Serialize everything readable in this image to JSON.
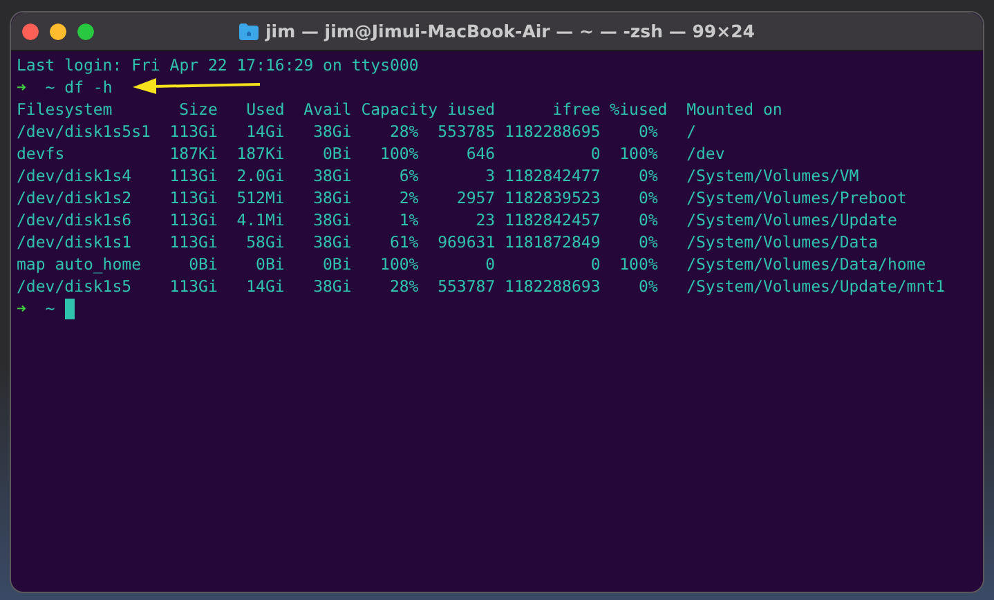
{
  "window": {
    "title": "jim — jim@Jimui-MacBook-Air — ~ — -zsh — 99×24"
  },
  "terminal": {
    "last_login": "Last login: Fri Apr 22 17:16:29 on ttys000",
    "command_prompt": {
      "arrow": "➜",
      "directory": "~",
      "command": "df -h"
    },
    "table": {
      "columns": [
        "Filesystem",
        "Size",
        "Used",
        "Avail",
        "Capacity",
        "iused",
        "ifree",
        "%iused",
        "Mounted on"
      ],
      "rows": [
        [
          "/dev/disk1s5s1",
          "113Gi",
          "14Gi",
          "38Gi",
          "28%",
          "553785",
          "1182288695",
          "0%",
          "/"
        ],
        [
          "devfs",
          "187Ki",
          "187Ki",
          "0Bi",
          "100%",
          "646",
          "0",
          "100%",
          "/dev"
        ],
        [
          "/dev/disk1s4",
          "113Gi",
          "2.0Gi",
          "38Gi",
          "6%",
          "3",
          "1182842477",
          "0%",
          "/System/Volumes/VM"
        ],
        [
          "/dev/disk1s2",
          "113Gi",
          "512Mi",
          "38Gi",
          "2%",
          "2957",
          "1182839523",
          "0%",
          "/System/Volumes/Preboot"
        ],
        [
          "/dev/disk1s6",
          "113Gi",
          "4.1Mi",
          "38Gi",
          "1%",
          "23",
          "1182842457",
          "0%",
          "/System/Volumes/Update"
        ],
        [
          "/dev/disk1s1",
          "113Gi",
          "58Gi",
          "38Gi",
          "61%",
          "969631",
          "1181872849",
          "0%",
          "/System/Volumes/Data"
        ],
        [
          "map auto_home",
          "0Bi",
          "0Bi",
          "0Bi",
          "100%",
          "0",
          "0",
          "100%",
          "/System/Volumes/Data/home"
        ],
        [
          "/dev/disk1s5",
          "113Gi",
          "14Gi",
          "38Gi",
          "28%",
          "553787",
          "1182288693",
          "0%",
          "/System/Volumes/Update/mnt1"
        ]
      ]
    },
    "final_prompt": {
      "arrow": "➜",
      "directory": "~"
    }
  }
}
